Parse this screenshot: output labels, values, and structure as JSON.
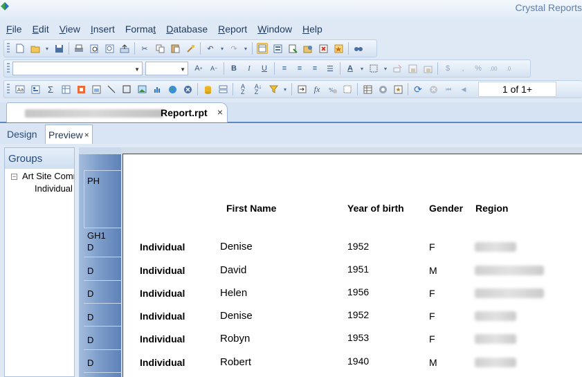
{
  "app": {
    "title": "Crystal Reports"
  },
  "menu": [
    "File",
    "Edit",
    "View",
    "Insert",
    "Format",
    "Database",
    "Report",
    "Window",
    "Help"
  ],
  "menu_mnemonic_index": [
    0,
    0,
    0,
    0,
    5,
    0,
    0,
    0,
    0
  ],
  "navigation": {
    "page_indicator": "1 of 1+"
  },
  "document_tab": {
    "filename": "Report.rpt",
    "close": "×"
  },
  "view_tabs": {
    "design": "Design",
    "preview": "Preview",
    "close": "×"
  },
  "groups_panel": {
    "title": "Groups",
    "toggle": "−",
    "root": "Art Site Comm",
    "child": "Individual"
  },
  "sections": {
    "page_header": "PH",
    "group_header": "GH1",
    "details": "D"
  },
  "report": {
    "headers": {
      "first_name": "First Name",
      "year_of_birth": "Year of birth",
      "gender": "Gender",
      "region": "Region"
    },
    "rows": [
      {
        "group": "Individual",
        "first_name": "Denise",
        "year": "1952",
        "gender": "F"
      },
      {
        "group": "Individual",
        "first_name": "David",
        "year": "1951",
        "gender": "M"
      },
      {
        "group": "Individual",
        "first_name": "Helen",
        "year": "1956",
        "gender": "F"
      },
      {
        "group": "Individual",
        "first_name": "Denise",
        "year": "1952",
        "gender": "F"
      },
      {
        "group": "Individual",
        "first_name": "Robyn",
        "year": "1953",
        "gender": "F"
      },
      {
        "group": "Individual",
        "first_name": "Robert",
        "year": "1940",
        "gender": "M"
      }
    ]
  },
  "toolbar_icons": {
    "standard": [
      "new-icon",
      "open-icon",
      "save-icon",
      "print-icon",
      "print-preview-icon",
      "export-icon",
      "cut-icon",
      "copy-icon",
      "paste-icon",
      "format-painter-icon",
      "undo-icon",
      "redo-icon",
      "toggle-field-view-icon",
      "report-explorer-icon",
      "dependency-checker-icon",
      "repository-explorer-icon",
      "find-icon"
    ],
    "formatting": [
      "increase-font-icon",
      "decrease-font-icon",
      "bold-icon",
      "italic-icon",
      "underline-icon",
      "align-left-icon",
      "align-center-icon",
      "align-right-icon",
      "justify-icon",
      "font-color-icon",
      "border-icon",
      "suppress-icon",
      "lock-format-icon",
      "lock-size-icon",
      "currency-icon",
      "thousands-icon",
      "percent-icon",
      "decimal-add-icon",
      "decimal-remove-icon"
    ],
    "insert": [
      "insert-text-object-icon",
      "insert-group-icon",
      "insert-summary-icon",
      "insert-cross-tab-icon",
      "insert-ole-icon",
      "insert-subreport-icon",
      "insert-line-icon",
      "insert-box-icon",
      "insert-picture-icon",
      "insert-chart-icon",
      "insert-map-icon",
      "insert-hyperlink-icon",
      "database-expert-icon",
      "group-expert-icon",
      "record-sort-icon",
      "select-expert-icon",
      "section-expert-icon",
      "formula-workshop-icon",
      "sql-expression-icon",
      "template-expert-icon",
      "report-options-icon",
      "highlighting-icon",
      "refresh-icon",
      "stop-icon",
      "first-page-icon",
      "previous-page-icon"
    ]
  },
  "colors": {
    "accent": "#5b86bf",
    "menu_text": "#1e395b",
    "title_text": "#5b7fb0",
    "active_button": "#fbd97a"
  }
}
